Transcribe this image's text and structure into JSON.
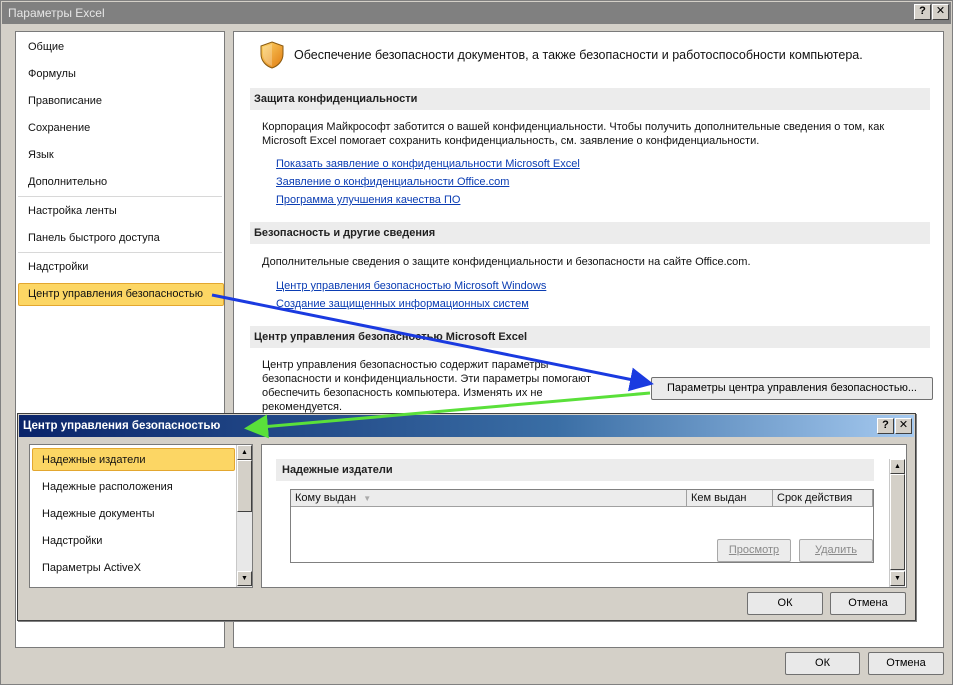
{
  "main_window": {
    "title": "Параметры Excel",
    "help_label": "?",
    "close_label": "✕"
  },
  "nav": {
    "items": [
      "Общие",
      "Формулы",
      "Правописание",
      "Сохранение",
      "Язык",
      "Дополнительно",
      "Настройка ленты",
      "Панель быстрого доступа",
      "Надстройки",
      "Центр управления безопасностью"
    ],
    "selected": "Центр управления безопасностью"
  },
  "content": {
    "headline": "Обеспечение безопасности документов, а также безопасности и работоспособности компьютера.",
    "privacy": {
      "title": "Защита конфиденциальности",
      "text_line1": "Корпорация Майкрософт заботится о вашей конфиденциальности. Чтобы получить дополнительные сведения о том, как",
      "text_line2": "Microsoft Excel помогает сохранить конфиденциальность, см. заявление о конфиденциальности.",
      "links": [
        "Показать заявление о конфиденциальности Microsoft Excel",
        "Заявление о конфиденциальности Office.com",
        "Программа улучшения качества ПО"
      ]
    },
    "security": {
      "title": "Безопасность и другие сведения",
      "text": "Дополнительные сведения о защите конфиденциальности и безопасности на сайте Office.com.",
      "links": [
        "Центр управления безопасностью Microsoft Windows",
        "Создание защищенных информационных систем"
      ]
    },
    "trust_center": {
      "title": "Центр управления безопасностью Microsoft Excel",
      "text_lines": [
        "Центр управления безопасностью содержит параметры",
        "безопасности и конфиденциальности. Эти параметры помогают",
        "обеспечить безопасность компьютера. Изменять их не",
        "рекомендуется."
      ],
      "button_label": "Параметры центра управления безопасностью..."
    }
  },
  "footer": {
    "ok_label": "ОК",
    "cancel_label": "Отмена"
  },
  "trust_dialog": {
    "title": "Центр управления безопасностью",
    "help_label": "?",
    "close_label": "✕",
    "nav_items": [
      "Надежные издатели",
      "Надежные расположения",
      "Надежные документы",
      "Надстройки",
      "Параметры ActiveX"
    ],
    "selected": "Надежные издатели",
    "section_title": "Надежные издатели",
    "table_headers": [
      "Кому выдан",
      "Кем выдан",
      "Срок действия"
    ],
    "view_label": "Просмотр",
    "remove_label": "Удалить",
    "ok_label": "ОК",
    "cancel_label": "Отмена"
  },
  "colors": {
    "selected_fill": "#fcd664",
    "link": "#0b3db3",
    "arrow_blue": "#1a3ae0",
    "arrow_green": "#5ae03a"
  }
}
